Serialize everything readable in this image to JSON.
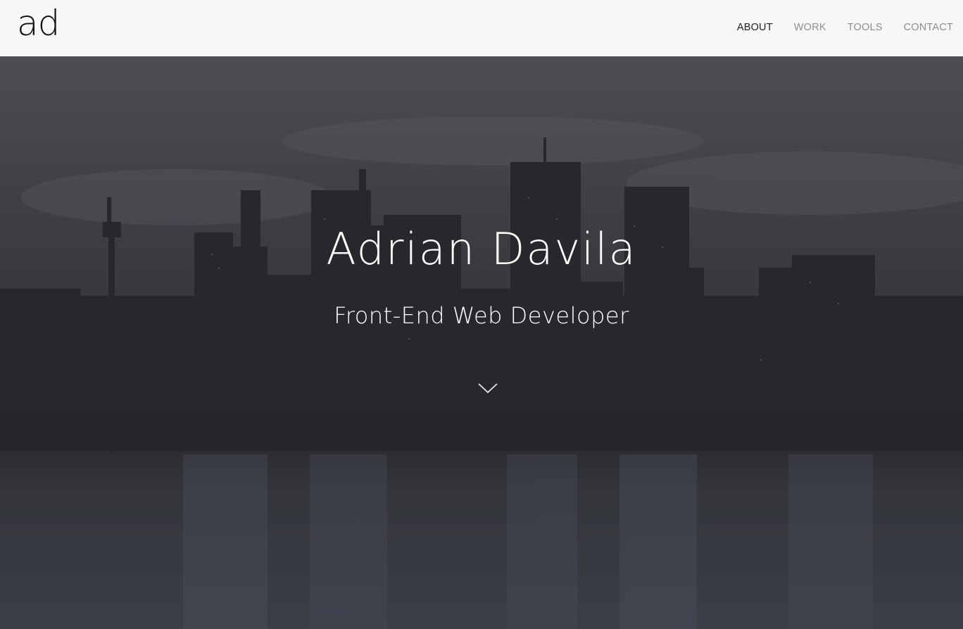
{
  "header": {
    "logo_text": "ad",
    "nav": [
      {
        "label": "ABOUT",
        "active": true
      },
      {
        "label": "WORK",
        "active": false
      },
      {
        "label": "TOOLS",
        "active": false
      },
      {
        "label": "CONTACT",
        "active": false
      }
    ]
  },
  "hero": {
    "title": "Adrian Davila",
    "subtitle": "Front-End Web Developer",
    "scroll_icon": "chevron-down-icon"
  },
  "colors": {
    "header_bg": "#f7f7f7",
    "nav_active": "#222222",
    "nav_inactive": "#8e8e8e",
    "hero_text": "#ffffff"
  }
}
